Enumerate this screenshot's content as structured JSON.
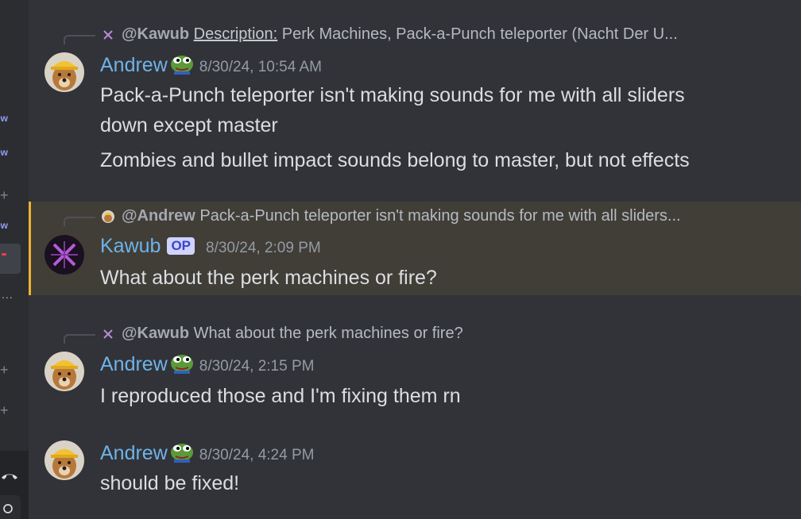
{
  "sidebar": {
    "new_label_1": "ew",
    "new_label_2": "ew",
    "new_label_3": "ew",
    "plus_symbol": "+",
    "dots": "..."
  },
  "messages": [
    {
      "reply": {
        "mention": "@Kawub",
        "label": "Description:",
        "text": "Perk Machines, Pack-a-Punch teleporter (Nacht Der U..."
      },
      "username": "Andrew",
      "timestamp": "8/30/24, 10:54 AM",
      "lines": [
        "Pack-a-Punch teleporter isn't making sounds for me with all sliders",
        "down except master",
        "Zombies and bullet impact sounds belong to master, but not effects"
      ]
    },
    {
      "reply": {
        "mention": "@Andrew",
        "text": "Pack-a-Punch teleporter isn't making sounds for me with all sliders..."
      },
      "username": "Kawub",
      "badge": "OP",
      "timestamp": "8/30/24, 2:09 PM",
      "lines": [
        "What about the perk machines or fire?"
      ]
    },
    {
      "reply": {
        "mention": "@Kawub",
        "text": "What about the perk machines or fire?"
      },
      "username": "Andrew",
      "timestamp": "8/30/24, 2:15 PM",
      "lines": [
        "I reproduced those and I'm fixing them rn"
      ]
    },
    {
      "username": "Andrew",
      "timestamp": "8/30/24, 4:24 PM",
      "lines": [
        "should be fixed!"
      ]
    }
  ],
  "colors": {
    "background": "#313338",
    "username": "#6fb3e8",
    "highlight": "#413e38",
    "highlight_bar": "#f0b232"
  }
}
